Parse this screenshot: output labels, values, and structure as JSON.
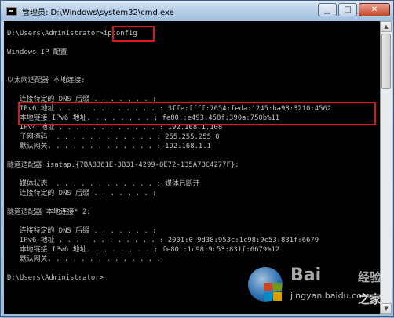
{
  "window": {
    "title": "管理员: D:\\Windows\\system32\\cmd.exe",
    "minimize_label": "▁",
    "maximize_label": "□",
    "close_label": "✕"
  },
  "console": {
    "lines": [
      "D:\\Users\\Administrator>ipconfig",
      "",
      "Windows IP 配置",
      "",
      "",
      "以太网适配器 本地连接:",
      "",
      "   连接特定的 DNS 后缀 . . . . . . . :",
      "   IPv6 地址 . . . . . . . . . . . . : 3ffe:ffff:7654:feda:1245:ba98:3210:4562",
      "   本地链接 IPv6 地址. . . . . . . . : fe80::e493:458f:390a:750b%11",
      "   IPv4 地址 . . . . . . . . . . . . : 192.168.1.108",
      "   子网掩码  . . . . . . . . . . . . : 255.255.255.0",
      "   默认网关. . . . . . . . . . . . . : 192.168.1.1",
      "",
      "隧道适配器 isatap.{7BA8361E-3B31-4299-8E72-135A7BC4277F}:",
      "",
      "   媒体状态  . . . . . . . . . . . . : 媒体已断开",
      "   连接特定的 DNS 后缀 . . . . . . . :",
      "",
      "隧道适配器 本地连接* 2:",
      "",
      "   连接特定的 DNS 后缀 . . . . . . . :",
      "   IPv6 地址 . . . . . . . . . . . . : 2001:0:9d38:953c:1c98:9c53:831f:6679",
      "   本地链接 IPv6 地址. . . . . . . . : fe80::1c98:9c53:831f:6679%12",
      "   默认网关. . . . . . . . . . . . . :",
      "",
      "D:\\Users\\Administrator>"
    ]
  },
  "scrollbar": {
    "up_arrow": "▲",
    "down_arrow": "▼"
  },
  "watermark": {
    "brand": "Bai",
    "suffix": "经验",
    "url": "jingyan.baidu.com",
    "extra": "之家"
  },
  "colors": {
    "console_text": "#c0c0c0",
    "console_bg": "#000000",
    "highlight": "#e0141a"
  }
}
